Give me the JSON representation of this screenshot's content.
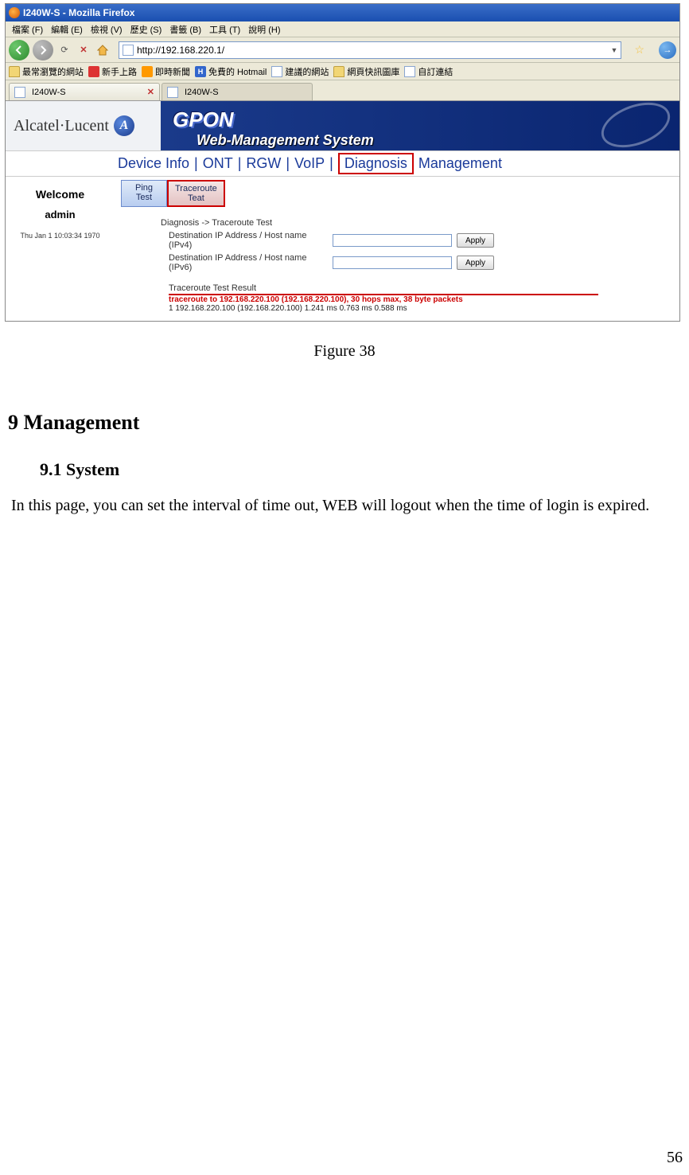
{
  "browser": {
    "window_title": "I240W-S - Mozilla Firefox",
    "menu": [
      "檔案 (F)",
      "編輯 (E)",
      "檢視 (V)",
      "歷史 (S)",
      "書籤 (B)",
      "工具 (T)",
      "說明 (H)"
    ],
    "url": "http://192.168.220.1/",
    "bookmarks": [
      "最常瀏覽的網站",
      "新手上路",
      "即時新聞",
      "免費的 Hotmail",
      "建議的網站",
      "網頁快訊圖庫",
      "自訂連結"
    ],
    "tabs": [
      {
        "label": "I240W-S",
        "active": true
      },
      {
        "label": "I240W-S",
        "active": false
      }
    ]
  },
  "banner": {
    "brand": "Alcatel·Lucent",
    "gpon": "GPON",
    "subtitle": "Web-Management System"
  },
  "nav": {
    "items": [
      "Device Info",
      "ONT",
      "RGW",
      "VoIP",
      "Diagnosis",
      "Management"
    ],
    "active": "Diagnosis"
  },
  "sidebar": {
    "welcome": "Welcome",
    "user": "admin",
    "timestamp": "Thu Jan 1 10:03:34 1970"
  },
  "subtabs": [
    {
      "line1": "Ping",
      "line2": "Test",
      "active": false
    },
    {
      "line1": "Traceroute",
      "line2": "Teat",
      "active": true
    }
  ],
  "page": {
    "breadcrumb": "Diagnosis -> Traceroute Test",
    "field_label_v4": "Destination IP Address / Host name (IPv4)",
    "field_label_v6": "Destination IP Address / Host name (IPv6)",
    "apply": "Apply",
    "result_head": "Traceroute Test Result",
    "result_line1": "traceroute to 192.168.220.100 (192.168.220.100), 30 hops max, 38 byte packets",
    "result_line2": "1 192.168.220.100 (192.168.220.100) 1.241 ms 0.763 ms 0.588 ms"
  },
  "doc": {
    "figure_caption": "Figure 38",
    "heading": "9   Management",
    "subheading": "9.1    System",
    "paragraph": "In this page, you can set the interval of time out, WEB will logout when the time of login is expired.",
    "page_number": "56"
  }
}
